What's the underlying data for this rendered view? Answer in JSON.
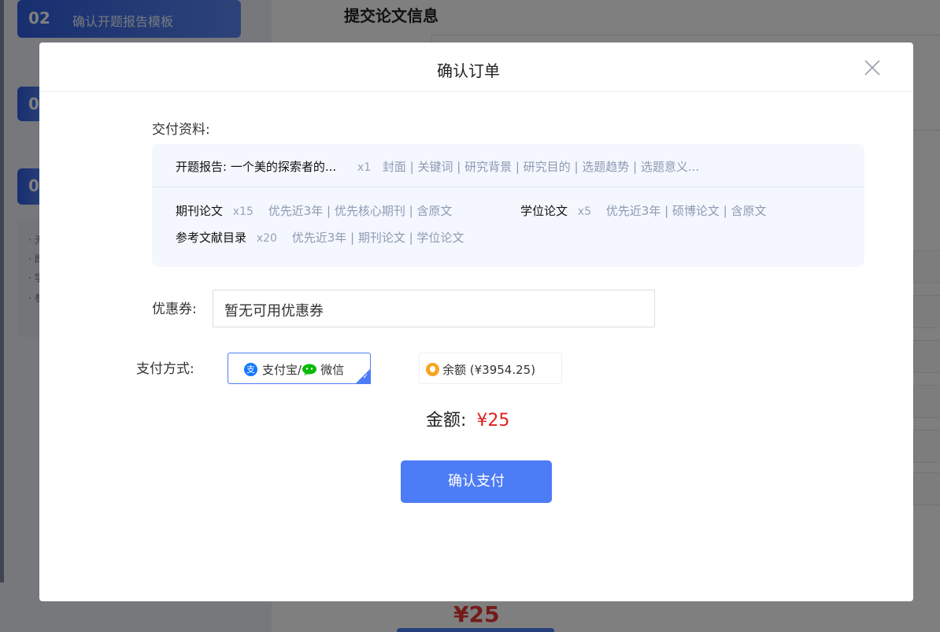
{
  "background": {
    "steps": [
      {
        "num": "02",
        "label": "确认开题报告模板"
      },
      {
        "num": "0"
      },
      {
        "num": "0"
      }
    ],
    "bullets": [
      "· 无",
      "· 即",
      "· 学",
      "· 参"
    ],
    "section_title": "提交论文信息",
    "bottom_price": "¥25"
  },
  "modal": {
    "title": "确认订单",
    "delivery_label": "交付资料:",
    "report": {
      "name": "开题报告: 一个美的探索者的...",
      "count": "x1",
      "tags": "封面 | 关键词 | 研究背景 | 研究目的 | 选题趋势 | 选题意义..."
    },
    "items": [
      {
        "name": "期刊论文",
        "count": "x15",
        "tags": "优先近3年 | 优先核心期刊 | 含原文"
      },
      {
        "name": "学位论文",
        "count": "x5",
        "tags": "优先近3年 | 硕博论文 | 含原文"
      },
      {
        "name": "参考文献目录",
        "count": "x20",
        "tags": "优先近3年 | 期刊论文 | 学位论文"
      }
    ],
    "coupon_label": "优惠券:",
    "coupon_value": "暂无可用优惠券",
    "payment_label": "支付方式:",
    "payment_options": [
      {
        "alipay": "支付宝/",
        "wechat": "微信",
        "selected": true
      },
      {
        "label": "余额 (¥3954.25)",
        "selected": false
      }
    ],
    "amount_label": "金额:",
    "amount_value": "¥25",
    "confirm_label": "确认支付"
  },
  "colors": {
    "primary": "#4c7cf6",
    "price_red": "#e02020",
    "alipay_blue": "#1677ff",
    "wechat_green": "#09bb07",
    "balance_orange": "#f6a623"
  }
}
